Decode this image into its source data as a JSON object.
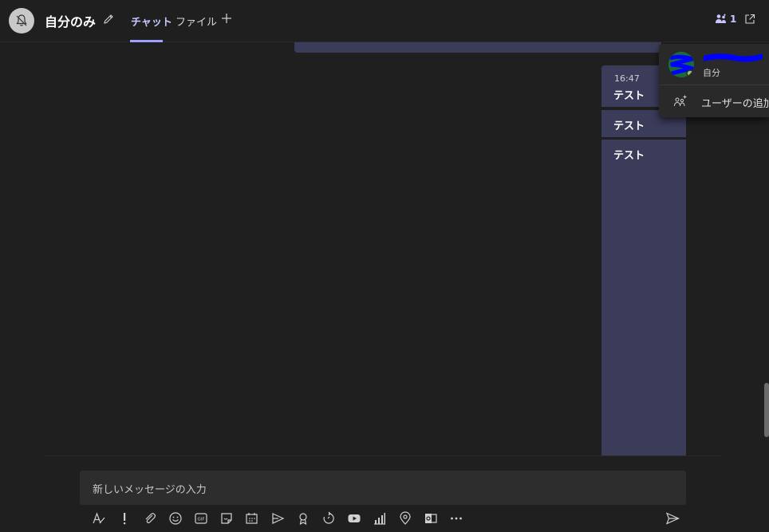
{
  "header": {
    "title": "自分のみ",
    "tabs": [
      {
        "label": "チャット",
        "active": true
      },
      {
        "label": "ファイル",
        "active": false
      }
    ],
    "participants_count": "1",
    "icons": {
      "group_avatar": "bell-slash-icon",
      "edit": "pencil-icon",
      "add_tab": "plus-icon",
      "participants": "people-icon",
      "popout": "popout-icon"
    }
  },
  "messages": [
    {
      "time": "16:47",
      "text": "テスト"
    },
    {
      "text": "テスト"
    },
    {
      "text": "テスト"
    }
  ],
  "composer": {
    "placeholder": "新しいメッセージの入力"
  },
  "toolbar": {
    "icons": [
      "format-icon",
      "important-icon",
      "attach-icon",
      "emoji-icon",
      "gif-icon",
      "sticker-icon",
      "meeting-icon",
      "stream-icon",
      "praise-icon",
      "loop-icon",
      "youtube-icon",
      "chart-icon",
      "location-icon",
      "outlook-icon",
      "more-icon"
    ],
    "send": "send-icon"
  },
  "flyout": {
    "self_label": "自分",
    "add_user_label": "ユーザーの追加"
  },
  "colors": {
    "accent": "#9ea2ff",
    "bubble": "#3b3c5a",
    "background": "#1f1f1f",
    "composer": "#2d2d2d",
    "redaction": "#0000ff"
  }
}
